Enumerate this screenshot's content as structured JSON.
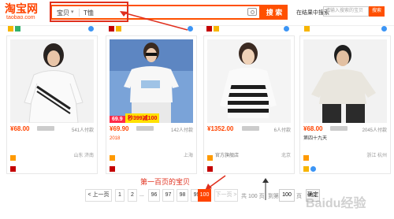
{
  "header": {
    "logo_text": "淘宝网",
    "logo_sub": "taobao.com",
    "search_category": "宝贝",
    "search_value": "T恤",
    "search_button": "搜 索",
    "shop_search_label": "在结果中搜索",
    "shop_search_placeholder": "请输入搜索的宝贝",
    "shop_search_button": "搜索"
  },
  "annotation": {
    "label": "第一百页的宝贝"
  },
  "products": [
    {
      "price": "¥68.00",
      "sold": "541人付款",
      "title_a": "",
      "title_b": "",
      "shop": "",
      "location": "山东 济南"
    },
    {
      "price": "¥69.90",
      "sold": "142人付款",
      "title_a": "",
      "title_b": "2018",
      "shop": "",
      "location": "上海",
      "promo_a": "69.9",
      "promo_b": "秒399减100"
    },
    {
      "price": "¥1352.00",
      "sold": "6人付款",
      "title_a": "",
      "title_b": "",
      "shop": "官方旗舰店",
      "location": "北京"
    },
    {
      "price": "¥68.00",
      "sold": "2045人付款",
      "title_a": "第四十九天",
      "title_b": "",
      "shop": "",
      "location": "浙江 杭州"
    }
  ],
  "pagination": {
    "prev": "< 上一页",
    "pages": [
      "1",
      "2",
      "96",
      "97",
      "98",
      "99",
      "100"
    ],
    "dots": "...",
    "next": "下一页 >",
    "total": "共 100 页",
    "goto": "到第",
    "current": "100",
    "page_unit": "页",
    "confirm": "确定"
  },
  "watermark": "Baidu经验",
  "colors": {
    "accent": "#ff5000",
    "price": "#ff4400",
    "annotation": "#e0301e"
  }
}
